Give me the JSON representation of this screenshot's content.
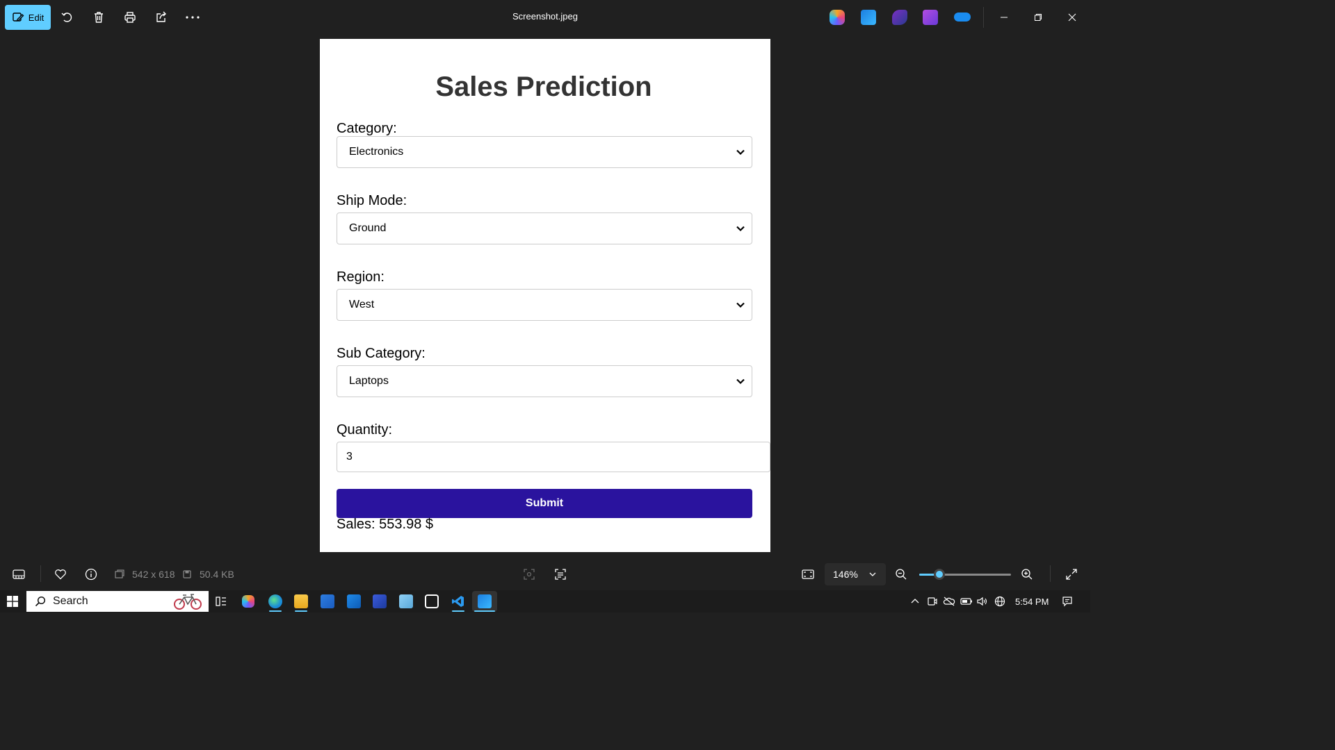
{
  "titlebar": {
    "edit_label": "Edit",
    "file_name": "Screenshot.jpeg",
    "tools": [
      "rotate-icon",
      "delete-icon",
      "print-icon",
      "share-icon",
      "more-icon"
    ],
    "apps": [
      "copilot-icon",
      "photos-icon",
      "clipchamp-icon",
      "clipchamp-video-icon",
      "onedrive-icon"
    ]
  },
  "form": {
    "title": "Sales Prediction",
    "category_label": "Category:",
    "category_value": "Electronics",
    "ship_mode_label": "Ship Mode:",
    "ship_mode_value": "Ground",
    "region_label": "Region:",
    "region_value": "West",
    "sub_category_label": "Sub Category:",
    "sub_category_value": "Laptops",
    "quantity_label": "Quantity:",
    "quantity_value": "3",
    "submit_label": "Submit",
    "result_text": "Sales: 553.98 $"
  },
  "statusbar": {
    "dimensions": "542 x 618",
    "file_size": "50.4 KB",
    "zoom": "146%",
    "zoom_slider_fraction": 0.22
  },
  "taskbar": {
    "search_placeholder": "Search",
    "time": "5:54 PM"
  },
  "colors": {
    "accent": "#60cdff",
    "submit": "#2a139e",
    "background": "#202020"
  }
}
